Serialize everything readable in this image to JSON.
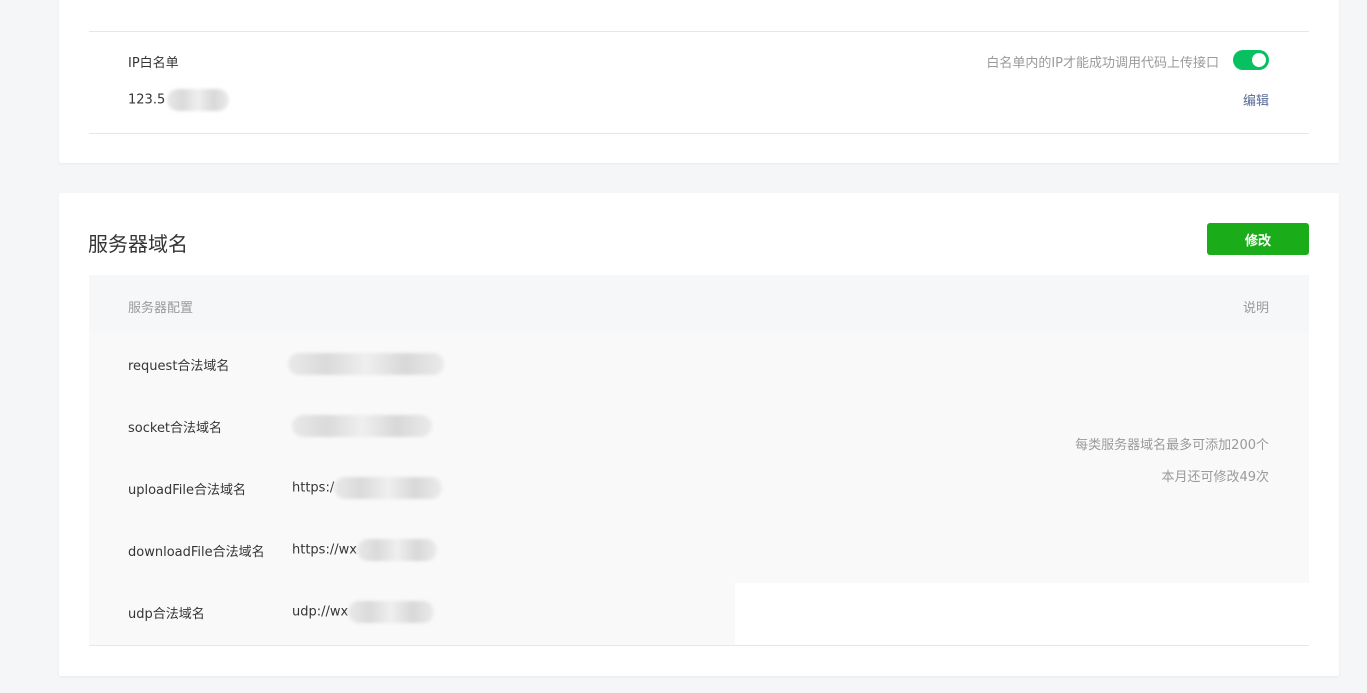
{
  "ip_whitelist": {
    "title": "IP白名单",
    "value_visible": "123.5",
    "tip": "白名单内的IP才能成功调用代码上传接口",
    "toggle_on": true,
    "edit_label": "编辑",
    "accent_color": "#07c160"
  },
  "server_domain": {
    "title": "服务器域名",
    "modify_label": "修改",
    "button_color": "#1aad19",
    "header": {
      "config_label": "服务器配置",
      "desc_label": "说明"
    },
    "rows": [
      {
        "label": "request合法域名",
        "value_visible": ""
      },
      {
        "label": "socket合法域名",
        "value_visible": ""
      },
      {
        "label": "uploadFile合法域名",
        "value_visible": "https:/"
      },
      {
        "label": "downloadFile合法域名",
        "value_visible": "https://wx"
      },
      {
        "label": "udp合法域名",
        "value_visible": "udp://wx"
      }
    ],
    "description": {
      "line1": "每类服务器域名最多可添加200个",
      "line2": "本月还可修改49次"
    }
  }
}
